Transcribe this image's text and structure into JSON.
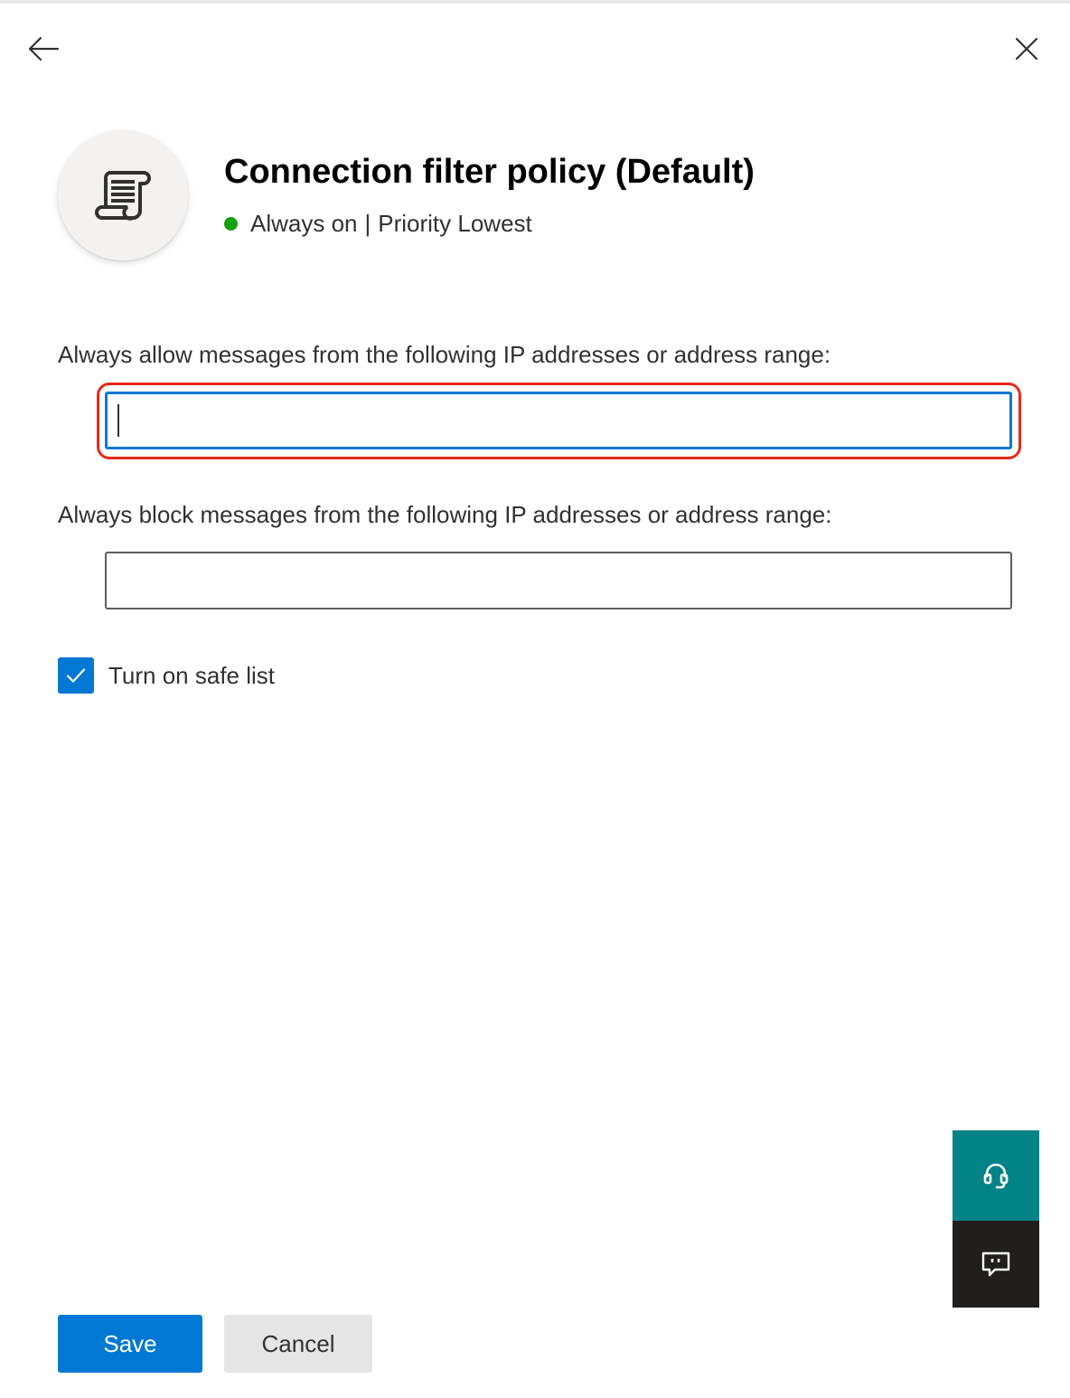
{
  "header": {
    "title": "Connection filter policy (Default)",
    "status_text": "Always on",
    "separator": "|",
    "priority_text": "Priority Lowest",
    "status_color": "#13a10e",
    "icon": "policy-scroll-icon"
  },
  "navigation": {
    "back_icon": "back-arrow-icon",
    "close_icon": "close-icon"
  },
  "fields": {
    "allow_label": "Always allow messages from the following IP addresses or address range:",
    "allow_value": "",
    "block_label": "Always block messages from the following IP addresses or address range:",
    "block_value": ""
  },
  "safe_list": {
    "label": "Turn on safe list",
    "checked": true
  },
  "side_tabs": {
    "support_icon": "headset-icon",
    "feedback_icon": "feedback-icon",
    "support_color": "#038387",
    "feedback_color": "#201f1e"
  },
  "actions": {
    "save_label": "Save",
    "cancel_label": "Cancel"
  },
  "colors": {
    "accent": "#0078d4",
    "highlight": "#e8281b"
  }
}
